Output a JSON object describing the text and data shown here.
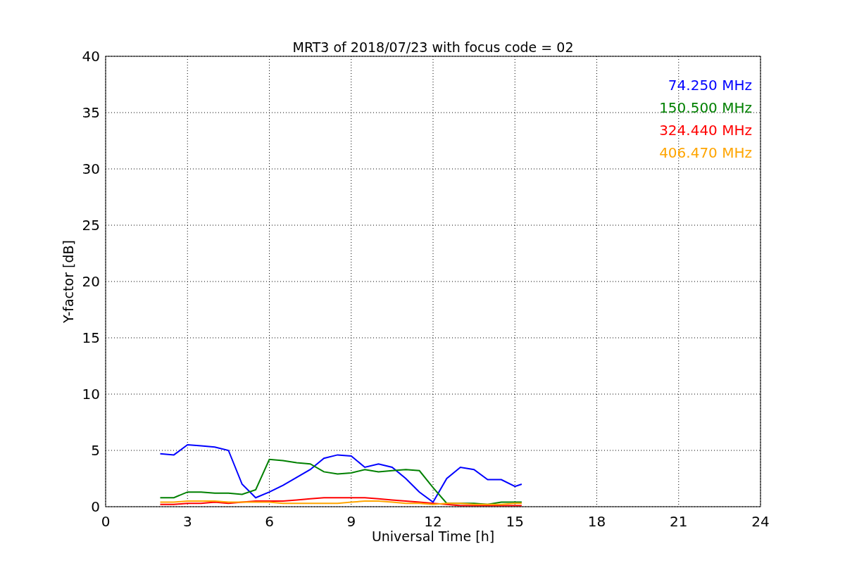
{
  "chart_data": {
    "type": "line",
    "title": "MRT3 of 2018/07/23 with focus code = 02",
    "xlabel": "Universal Time [h]",
    "ylabel": "Y-factor [dB]",
    "x": [
      2,
      2.5,
      3,
      3.5,
      4,
      4.5,
      5,
      5.5,
      6,
      6.5,
      7,
      7.5,
      8,
      8.5,
      9,
      9.5,
      10,
      10.5,
      11,
      11.5,
      12,
      12.5,
      13,
      13.5,
      14,
      14.5,
      15,
      15.25
    ],
    "series": [
      {
        "name": "74.250 MHz",
        "color": "#0000ff",
        "values": [
          4.7,
          4.6,
          5.5,
          5.4,
          5.3,
          5.0,
          2.0,
          0.8,
          1.3,
          1.9,
          2.6,
          3.3,
          4.3,
          4.6,
          4.5,
          3.5,
          3.8,
          3.5,
          2.5,
          1.3,
          0.4,
          2.5,
          3.5,
          3.3,
          2.4,
          2.4,
          1.8,
          2.0
        ]
      },
      {
        "name": "150.500 MHz",
        "color": "#008000",
        "values": [
          0.8,
          0.8,
          1.3,
          1.3,
          1.2,
          1.2,
          1.1,
          1.5,
          4.2,
          4.1,
          3.9,
          3.8,
          3.1,
          2.9,
          3.0,
          3.3,
          3.1,
          3.2,
          3.3,
          3.2,
          1.7,
          0.3,
          0.3,
          0.3,
          0.2,
          0.4,
          0.4,
          0.4
        ]
      },
      {
        "name": "324.440 MHz",
        "color": "#ff0000",
        "values": [
          0.2,
          0.2,
          0.3,
          0.3,
          0.4,
          0.3,
          0.4,
          0.5,
          0.5,
          0.5,
          0.6,
          0.7,
          0.8,
          0.8,
          0.8,
          0.8,
          0.7,
          0.6,
          0.5,
          0.4,
          0.3,
          0.2,
          0.1,
          0.1,
          0.1,
          0.1,
          0.1,
          0.1
        ]
      },
      {
        "name": "406.470 MHz",
        "color": "#ffa500",
        "values": [
          0.4,
          0.4,
          0.5,
          0.5,
          0.5,
          0.4,
          0.4,
          0.4,
          0.4,
          0.3,
          0.3,
          0.3,
          0.3,
          0.3,
          0.4,
          0.5,
          0.5,
          0.4,
          0.3,
          0.3,
          0.2,
          0.3,
          0.3,
          0.2,
          0.2,
          0.2,
          0.3,
          0.3
        ]
      }
    ],
    "grid": true,
    "xlim": [
      0,
      24
    ],
    "ylim": [
      0,
      40
    ],
    "xticks": [
      0,
      3,
      6,
      9,
      12,
      15,
      18,
      21,
      24
    ],
    "yticks": [
      0,
      5,
      10,
      15,
      20,
      25,
      30,
      35,
      40
    ]
  }
}
